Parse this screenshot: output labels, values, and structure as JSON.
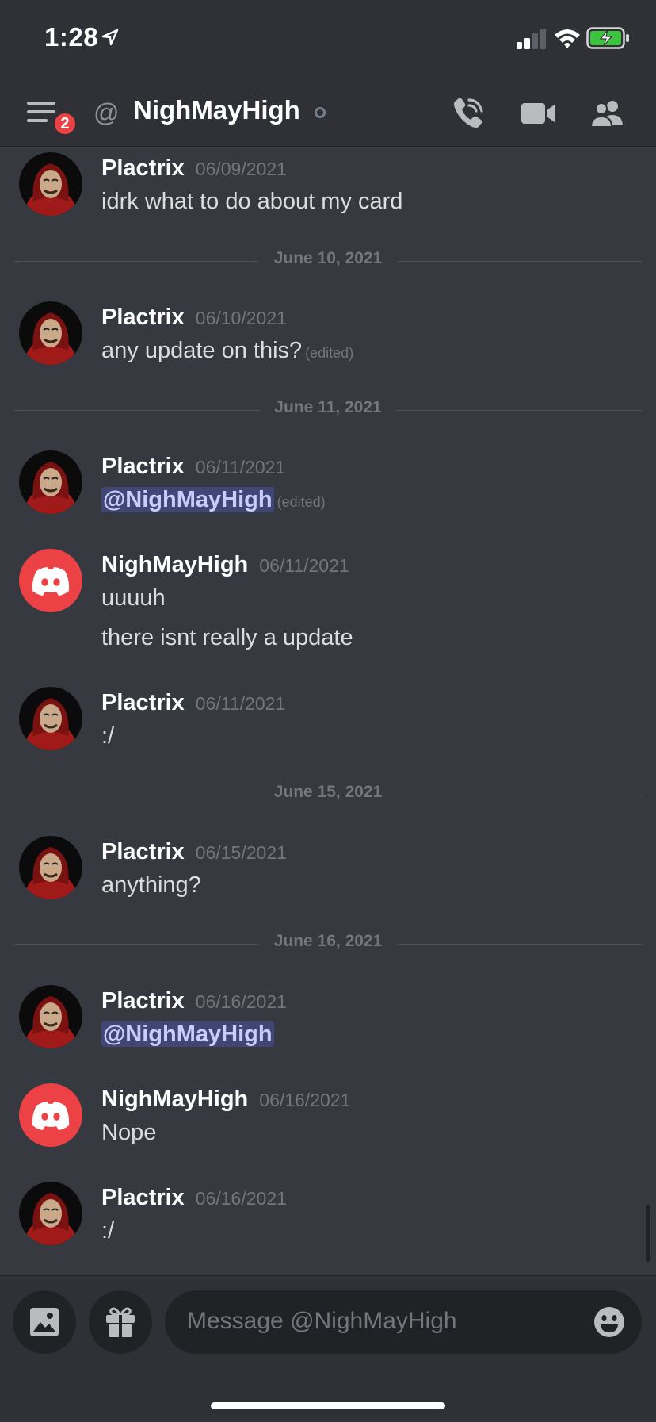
{
  "status_bar": {
    "time": "1:28"
  },
  "header": {
    "menu_badge": "2",
    "channel_prefix": "@",
    "title": "NighMayHigh",
    "icons": [
      "menu-icon",
      "at-icon",
      "phone-call-icon",
      "video-camera-icon",
      "members-icon"
    ]
  },
  "colors": {
    "background": "#36393f",
    "header": "#2f3136",
    "mention_bg": "#414675",
    "discord_red": "#ed4245",
    "badge": "#ed4245"
  },
  "dividers": [
    "June 10, 2021",
    "June 11, 2021",
    "June 15, 2021",
    "June 16, 2021"
  ],
  "messages": [
    {
      "author": "Plactrix",
      "timestamp": "06/09/2021",
      "lines": [
        "idrk what to do about my card"
      ]
    },
    {
      "author": "Plactrix",
      "timestamp": "06/10/2021",
      "lines": [
        "any update on this?"
      ],
      "edited": "(edited)"
    },
    {
      "author": "Plactrix",
      "timestamp": "06/11/2021",
      "mention": "@NighMayHigh",
      "edited": "(edited)"
    },
    {
      "author": "NighMayHigh",
      "timestamp": "06/11/2021",
      "lines": [
        "uuuuh",
        "there isnt really a update"
      ]
    },
    {
      "author": "Plactrix",
      "timestamp": "06/11/2021",
      "lines": [
        ":/"
      ]
    },
    {
      "author": "Plactrix",
      "timestamp": "06/15/2021",
      "lines": [
        "anything?"
      ]
    },
    {
      "author": "Plactrix",
      "timestamp": "06/16/2021",
      "mention": "@NighMayHigh"
    },
    {
      "author": "NighMayHigh",
      "timestamp": "06/16/2021",
      "lines": [
        "Nope"
      ]
    },
    {
      "author": "Plactrix",
      "timestamp": "06/16/2021",
      "lines": [
        ":/"
      ]
    }
  ],
  "input": {
    "placeholder": "Message @NighMayHigh",
    "icons": [
      "image-icon",
      "gift-icon",
      "emoji-icon"
    ]
  }
}
